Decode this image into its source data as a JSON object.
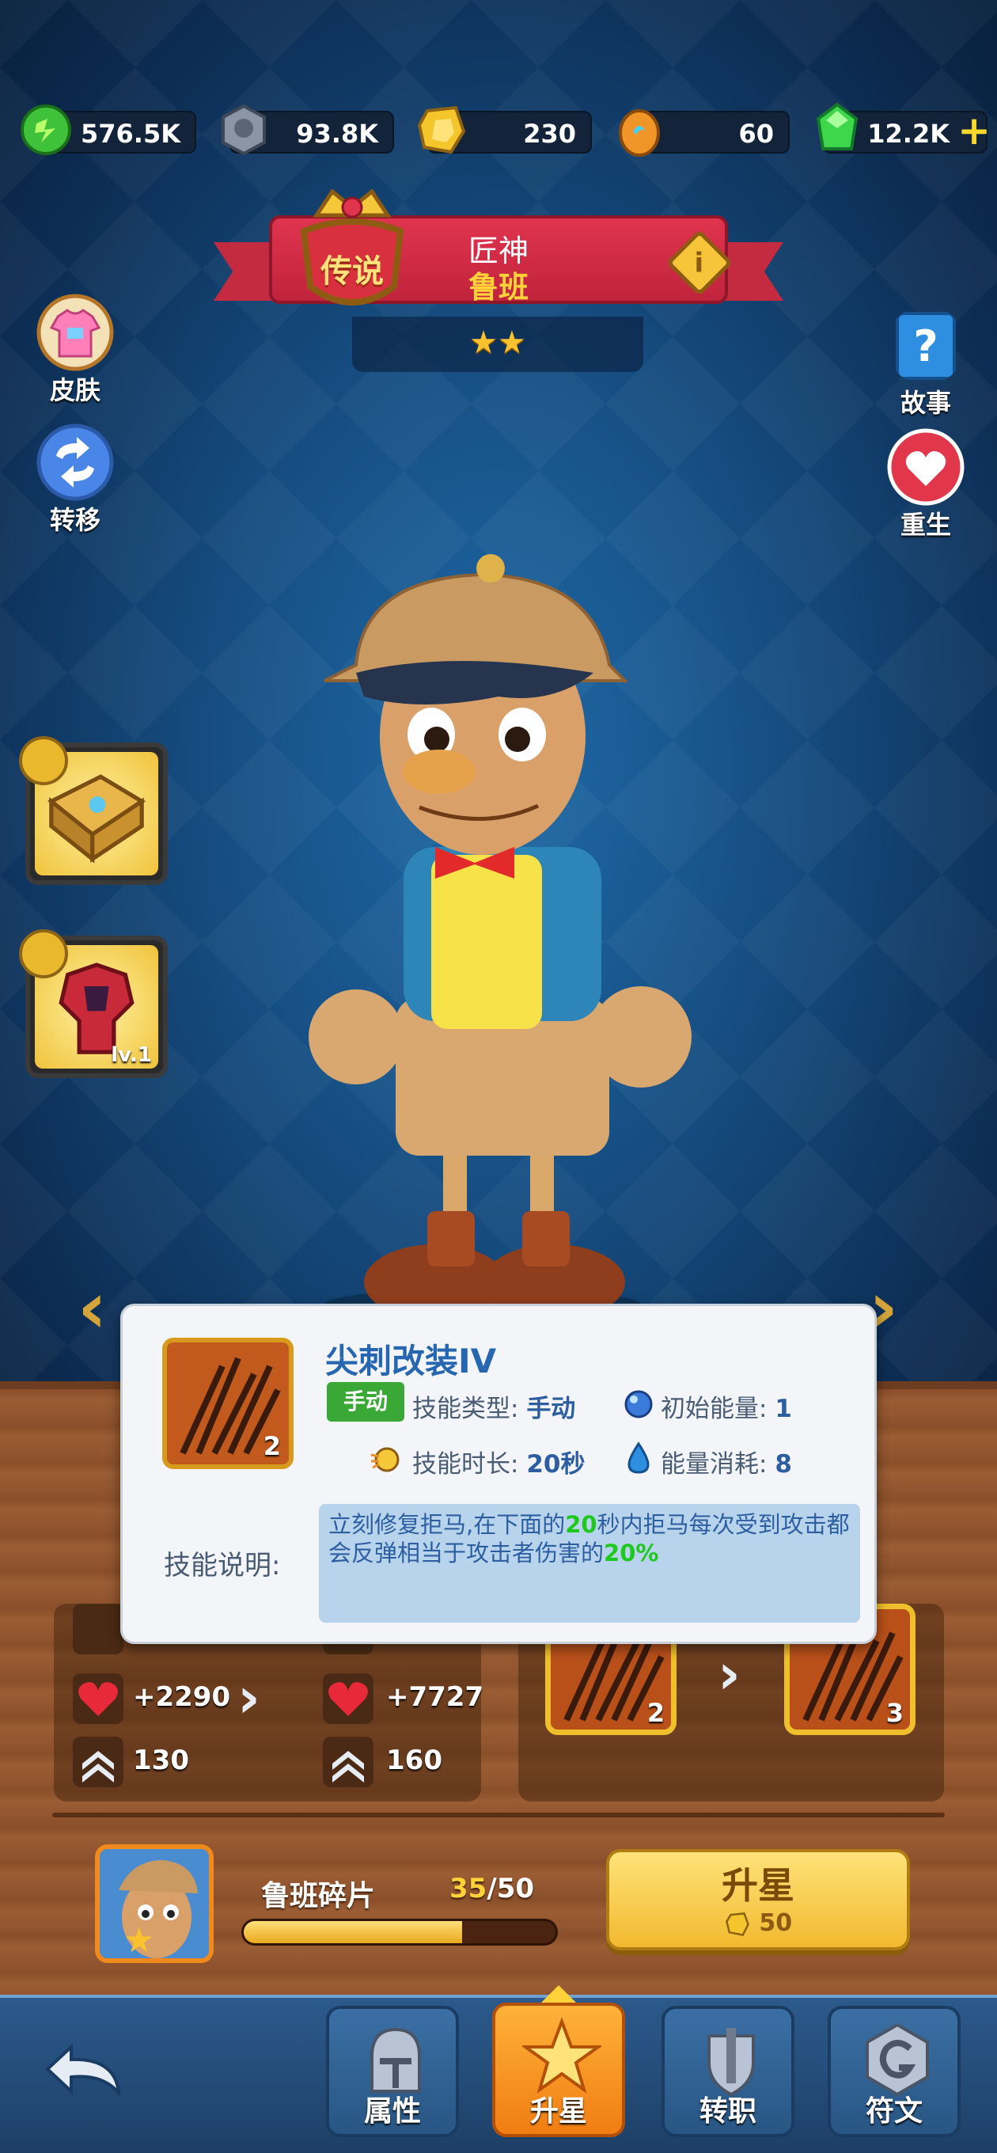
{
  "currencies": [
    {
      "icon": "green-energy-icon",
      "value": "576.5K"
    },
    {
      "icon": "stone-badge-icon",
      "value": "93.8K"
    },
    {
      "icon": "gold-crystal-icon",
      "value": "230"
    },
    {
      "icon": "flame-egg-icon",
      "value": "60"
    },
    {
      "icon": "green-gem-icon",
      "value": "12.2K"
    }
  ],
  "hero": {
    "rarity": "传说",
    "title": "匠神",
    "name": "鲁班",
    "stars": 2
  },
  "left_buttons": {
    "skin": "皮肤",
    "transfer": "转移"
  },
  "right_buttons": {
    "story": "故事",
    "rebirth": "重生"
  },
  "equipment": [
    {
      "icon": "spellbook-icon",
      "level": ""
    },
    {
      "icon": "red-armor-icon",
      "level": "lv.1"
    }
  ],
  "skill_tooltip": {
    "name": "尖刺改装IV",
    "icon": "spike-icon",
    "icon_count": "2",
    "tag": "手动",
    "type_label": "技能类型:",
    "type_value": "手动",
    "initial_energy_label": "初始能量:",
    "initial_energy_value": "1",
    "duration_label": "技能时长:",
    "duration_value": "20秒",
    "cost_label": "能量消耗:",
    "cost_value": "8",
    "desc_label": "技能说明:",
    "desc_part1": "立刻修复拒马,在下面的",
    "desc_hl1": "20",
    "desc_part2": "秒内拒马每次受到攻击都会反弹相当于攻击者伤害的",
    "desc_hl2": "20%"
  },
  "stats": {
    "current": {
      "hp": "+2290",
      "rank": "130"
    },
    "next": {
      "hp": "+7727",
      "rank": "160"
    }
  },
  "skill_upgrade": {
    "from": "2",
    "to": "3"
  },
  "shards": {
    "label": "鲁班碎片",
    "current": "35",
    "separator": "/",
    "required": "50",
    "progress": 0.7
  },
  "upstar_button": {
    "label": "升星",
    "cost": "50"
  },
  "nav": {
    "tabs": [
      {
        "label": "属性",
        "icon": "knight-helmet-icon",
        "active": false
      },
      {
        "label": "升星",
        "icon": "star-icon",
        "active": true
      },
      {
        "label": "转职",
        "icon": "sword-shield-icon",
        "active": false
      },
      {
        "label": "符文",
        "icon": "rune-icon",
        "active": false
      }
    ]
  },
  "colors": {
    "accent_gold": "#f2b92e",
    "ribbon_red": "#c42a40",
    "highlight_green": "#1ec81e"
  }
}
